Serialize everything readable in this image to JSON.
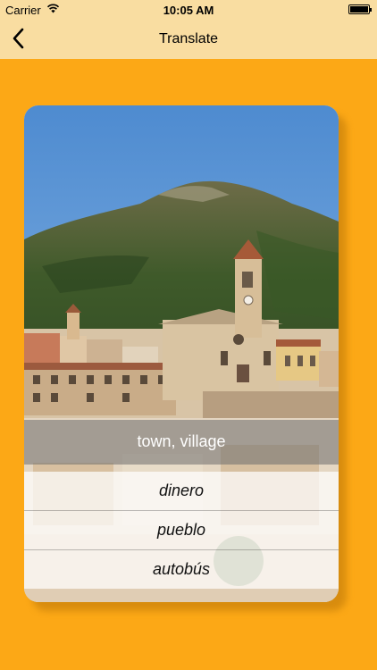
{
  "status": {
    "carrier": "Carrier",
    "time": "10:05 AM"
  },
  "nav": {
    "title": "Translate",
    "back_icon": "chevron-left-icon"
  },
  "card": {
    "prompt": "town, village",
    "options": [
      "dinero",
      "pueblo",
      "autobús"
    ]
  },
  "colors": {
    "background": "#FCA816",
    "navbar": "#F9DDA1"
  }
}
